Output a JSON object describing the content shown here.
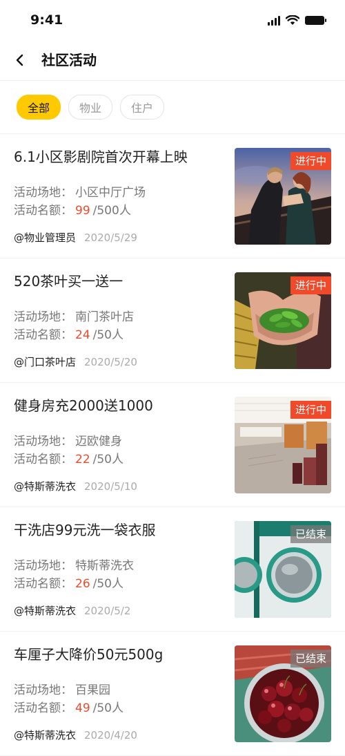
{
  "status_bar": {
    "time": "9:41"
  },
  "nav": {
    "title": "社区活动",
    "back_icon": "chevron-left-icon"
  },
  "filters": [
    {
      "label": "全部",
      "active": true
    },
    {
      "label": "物业",
      "active": false
    },
    {
      "label": "住户",
      "active": false
    }
  ],
  "labels": {
    "venue": "活动场地：",
    "quota": "活动名额："
  },
  "activities": [
    {
      "title": "6.1小区影剧院首次开幕上映",
      "venue": "小区中厅广场",
      "count": "99",
      "total": "/500人",
      "author": "@物业管理员",
      "date": "2020/5/29",
      "status": "进行中",
      "image": "movie-couple-photo"
    },
    {
      "title": "520茶叶买一送一",
      "venue": "南门茶叶店",
      "count": "24",
      "total": "/50人",
      "author": "@门口茶叶店",
      "date": "2020/5/20",
      "status": "进行中",
      "image": "tea-leaves-photo"
    },
    {
      "title": "健身房充2000送1000",
      "venue": "迈欧健身",
      "count": "22",
      "total": "/50人",
      "author": "@特斯蒂洗衣",
      "date": "2020/5/10",
      "status": "进行中",
      "image": "gym-photo"
    },
    {
      "title": "干洗店99元洗一袋衣服",
      "venue": "特斯蒂洗衣",
      "count": "26",
      "total": "/50人",
      "author": "@特斯蒂洗衣",
      "date": "2020/5/2",
      "status": "已结束",
      "image": "washing-machine-photo"
    },
    {
      "title": "车厘子大降价50元500g",
      "venue": "百果园",
      "count": "49",
      "total": "/50人",
      "author": "@特斯蒂洗衣",
      "date": "2020/4/20",
      "status": "已结束",
      "image": "cherries-photo"
    }
  ],
  "colors": {
    "accent": "#FFC900",
    "ongoing": "#F04A2B",
    "ended": "#8a8a8a",
    "highlight": "#F04A2B"
  }
}
